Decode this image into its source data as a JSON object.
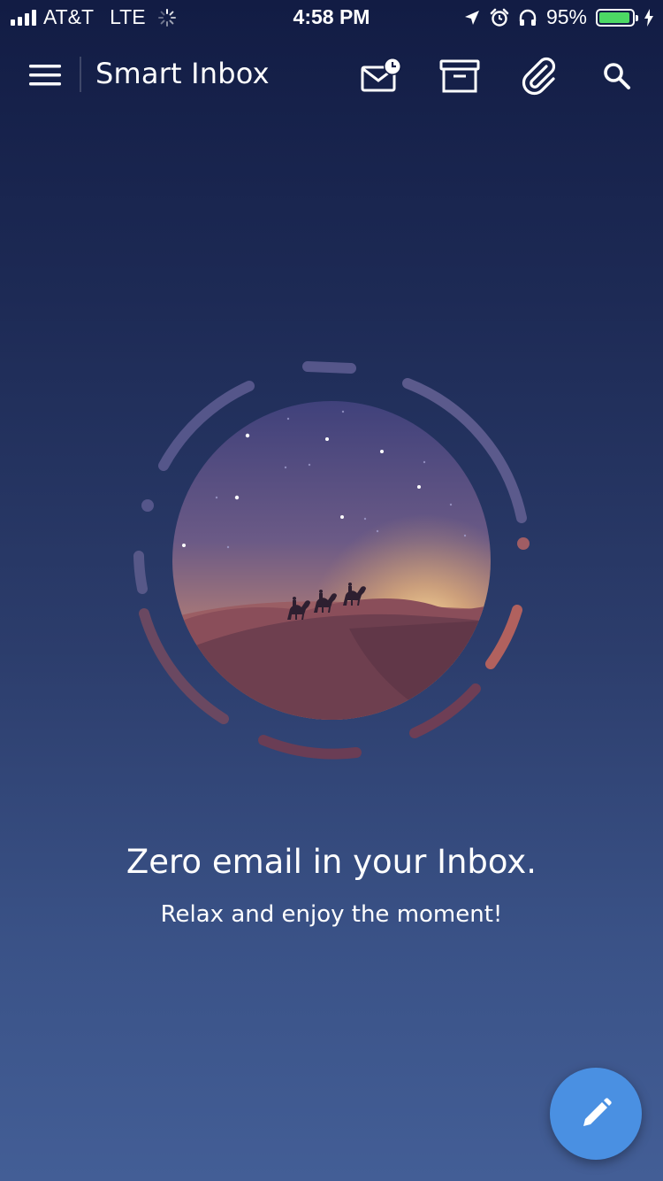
{
  "status_bar": {
    "carrier": "AT&T",
    "network": "LTE",
    "time": "4:58 PM",
    "battery_percent": "95%",
    "battery_level": 0.95,
    "icons": [
      "signal-icon",
      "loading-spinner-icon",
      "location-arrow-icon",
      "alarm-icon",
      "headphones-icon",
      "battery-icon",
      "charging-bolt-icon"
    ]
  },
  "app_bar": {
    "title": "Smart Inbox",
    "icons": [
      "menu-icon",
      "snoozed-mail-icon",
      "archive-icon",
      "paperclip-icon",
      "search-icon"
    ]
  },
  "empty_state": {
    "title": "Zero email in your Inbox.",
    "subtitle": "Relax and enjoy the moment!"
  },
  "fab": {
    "icon": "pencil-icon"
  },
  "colors": {
    "background_top": "#121c44",
    "background_bottom": "#435e96",
    "fab": "#4a90e2",
    "battery_fill": "#4cd964"
  }
}
